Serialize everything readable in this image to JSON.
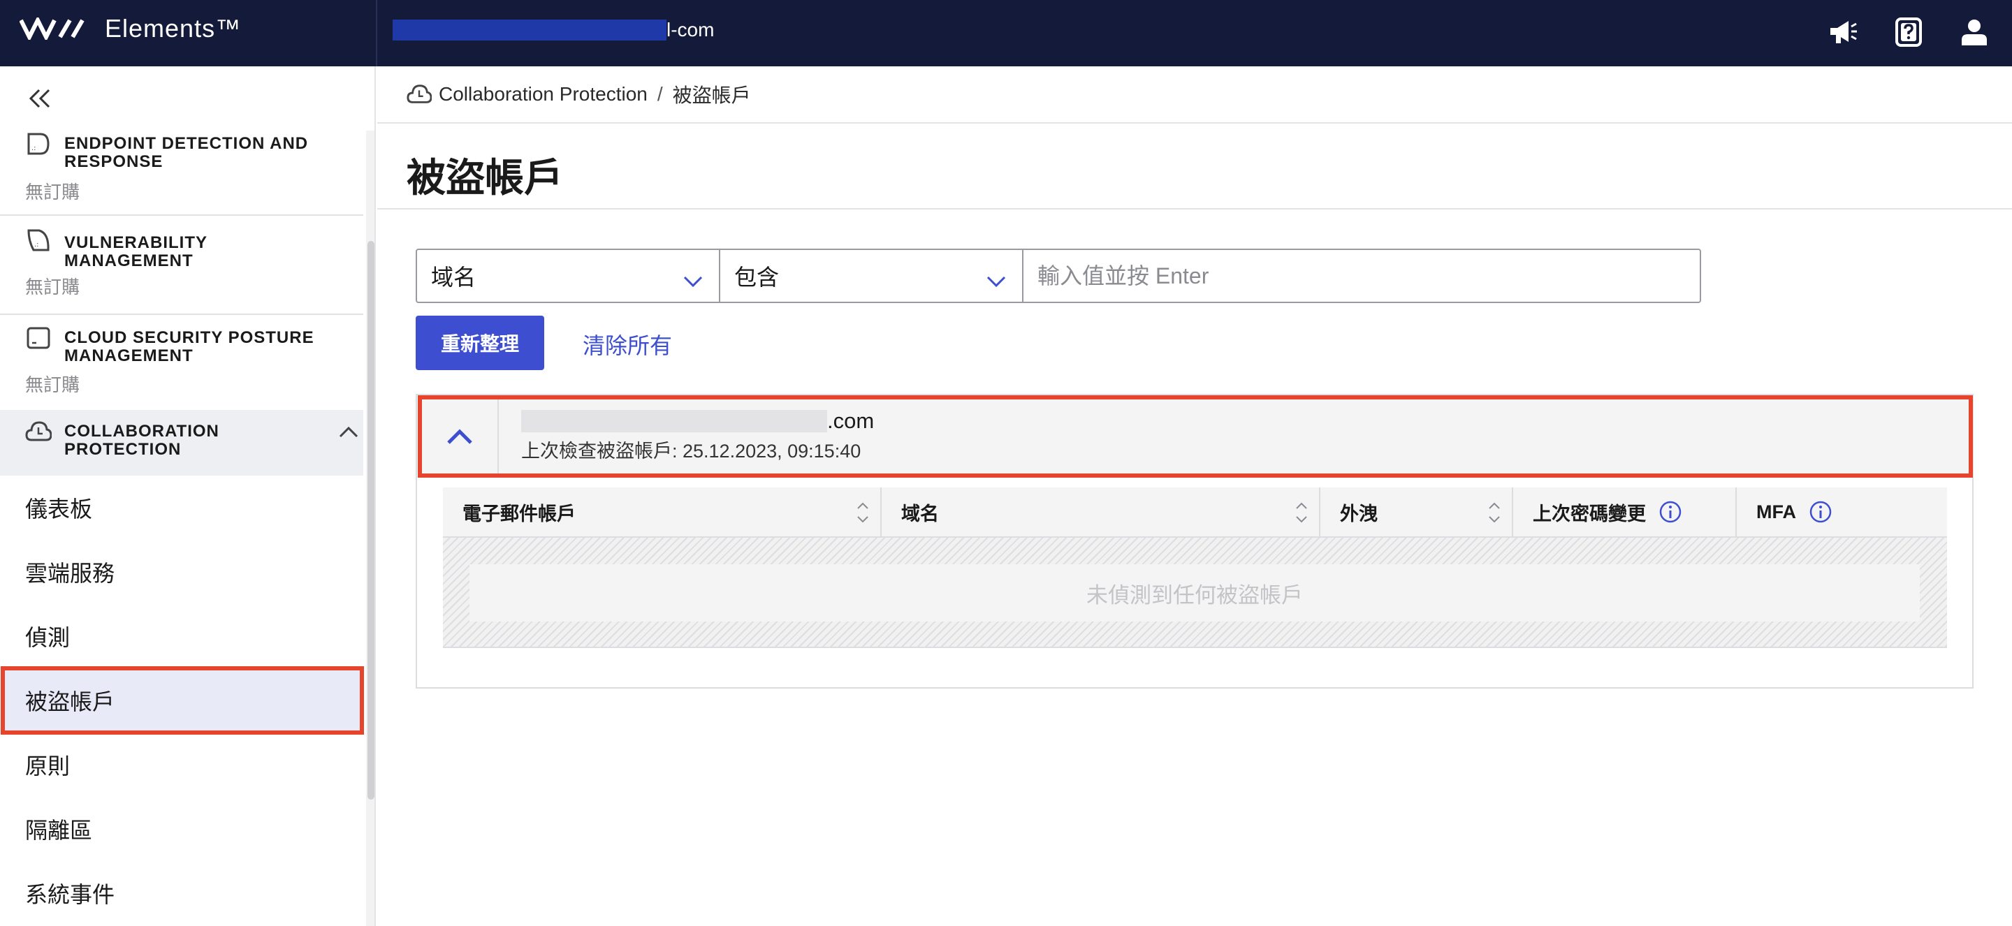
{
  "header": {
    "logo_text": "Elements™",
    "org_suffix": "l-com",
    "colors": {
      "bar": "#141a3a",
      "redaction": "#1f3aa8"
    },
    "icons": [
      "announcement-icon",
      "help-icon",
      "user-icon"
    ]
  },
  "sidebar": {
    "collapse_icon": "double-chevron-left-icon",
    "products": [
      {
        "title": "ENDPOINT DETECTION AND RESPONSE",
        "status": "無訂購",
        "icon": "edr-icon"
      },
      {
        "title": "VULNERABILITY MANAGEMENT",
        "status": "無訂購",
        "icon": "vulnerability-icon"
      },
      {
        "title": "CLOUD SECURITY POSTURE MANAGEMENT",
        "status": "無訂購",
        "icon": "cspm-icon"
      }
    ],
    "expanded_product": {
      "title": "COLLABORATION PROTECTION",
      "icon": "cloud-icon"
    },
    "nav": [
      {
        "label": "儀表板"
      },
      {
        "label": "雲端服務"
      },
      {
        "label": "偵測"
      },
      {
        "label": "被盜帳戶",
        "active": true
      },
      {
        "label": "原則"
      },
      {
        "label": "隔離區"
      },
      {
        "label": "系統事件"
      }
    ]
  },
  "breadcrumb": {
    "root": "Collaboration Protection",
    "separator": "/",
    "current": "被盜帳戶"
  },
  "page": {
    "title": "被盜帳戶"
  },
  "filter": {
    "field_value": "域名",
    "operator_value": "包含",
    "input_placeholder": "輸入值並按 Enter",
    "input_value": ""
  },
  "actions": {
    "refresh_label": "重新整理",
    "clear_label": "清除所有",
    "accent": "#3d4fd0"
  },
  "domain_card": {
    "domain_suffix": ".com",
    "last_check": "上次檢查被盜帳戶: 25.12.2023, 09:15:40",
    "highlight_color": "#e6442c"
  },
  "table": {
    "columns": [
      {
        "label": "電子郵件帳戶",
        "sortable": true
      },
      {
        "label": "域名",
        "sortable": true
      },
      {
        "label": "外洩",
        "sortable": true
      },
      {
        "label": "上次密碼變更",
        "info": true
      },
      {
        "label": "MFA",
        "info": true
      }
    ],
    "empty_message": "未偵測到任何被盜帳戶"
  }
}
